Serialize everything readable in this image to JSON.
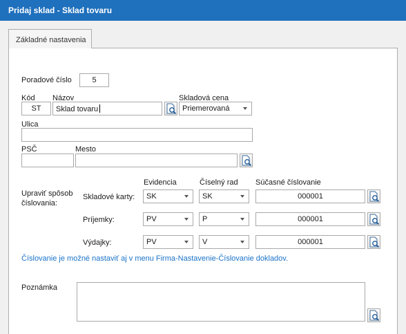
{
  "window": {
    "title": "Pridaj sklad - Sklad tovaru"
  },
  "tabs": [
    {
      "label": "Základné nastavenia"
    }
  ],
  "form": {
    "poradove_cislo": {
      "label": "Poradové číslo",
      "value": "5"
    },
    "kod": {
      "label": "Kód",
      "value": "ST"
    },
    "nazov": {
      "label": "Názov",
      "value": "Sklad tovaru"
    },
    "skladova_cena": {
      "label": "Skladová cena",
      "value": "Priemerovaná"
    },
    "ulica": {
      "label": "Ulica",
      "value": ""
    },
    "psc": {
      "label": "PSČ",
      "value": ""
    },
    "mesto": {
      "label": "Mesto",
      "value": ""
    }
  },
  "numbering": {
    "label": "Upraviť spôsob číslovania:",
    "col_evidencia": "Evidencia",
    "col_rad": "Číselný rad",
    "col_current": "Súčasné číslovanie",
    "rows": [
      {
        "label": "Skladové karty:",
        "evidencia": "SK",
        "rad": "SK",
        "current": "000001"
      },
      {
        "label": "Príjemky:",
        "evidencia": "PV",
        "rad": "P",
        "current": "000001"
      },
      {
        "label": "Výdajky:",
        "evidencia": "PV",
        "rad": "V",
        "current": "000001"
      }
    ],
    "note": "Číslovanie je možné nastaviť aj v menu Firma-Nastavenie-Číslovanie dokladov."
  },
  "poznamka": {
    "label": "Poznámka",
    "value": ""
  },
  "icons": {
    "lookup": "search-document-icon",
    "dropdown": "chevron-down-icon"
  },
  "colors": {
    "titlebar": "#1f70bd",
    "link": "#1a73c8"
  }
}
